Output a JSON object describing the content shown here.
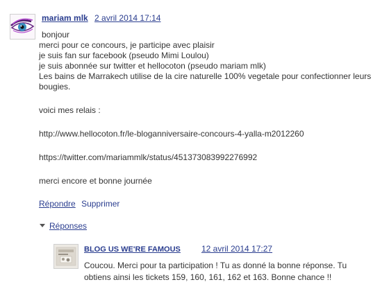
{
  "comment": {
    "author": "mariam mlk",
    "date": "2 avril 2014 17:14",
    "lines": {
      "l1": "bonjour",
      "l2": "merci pour ce concours, je participe avec plaisir",
      "l3": "je suis fan sur facebook (pseudo Mimi Loulou)",
      "l4": "je suis abonnée sur twitter et hellocoton (pseudo mariam mlk)",
      "l5": "Les bains de Marrakech utilise de la cire naturelle 100% vegetale pour confectionner leurs bougies.",
      "l6": "voici mes relais :",
      "l7": "http://www.hellocoton.fr/le-bloganniversaire-concours-4-yalla-m2012260",
      "l8": "https://twitter.com/mariammlk/status/451373083992276992",
      "l9": "merci encore et bonne journée"
    },
    "actions": {
      "reply": "Répondre",
      "delete": "Supprimer"
    }
  },
  "replies": {
    "toggle_label": "Réponses",
    "items": [
      {
        "author": "BLOG US WE'RE FAMOUS",
        "date": "12 avril 2014 17:27",
        "text": "Coucou. Merci pour ta participation ! Tu as donné la bonne réponse. Tu obtiens ainsi les tickets 159, 160, 161, 162 et 163. Bonne chance !!"
      }
    ]
  }
}
